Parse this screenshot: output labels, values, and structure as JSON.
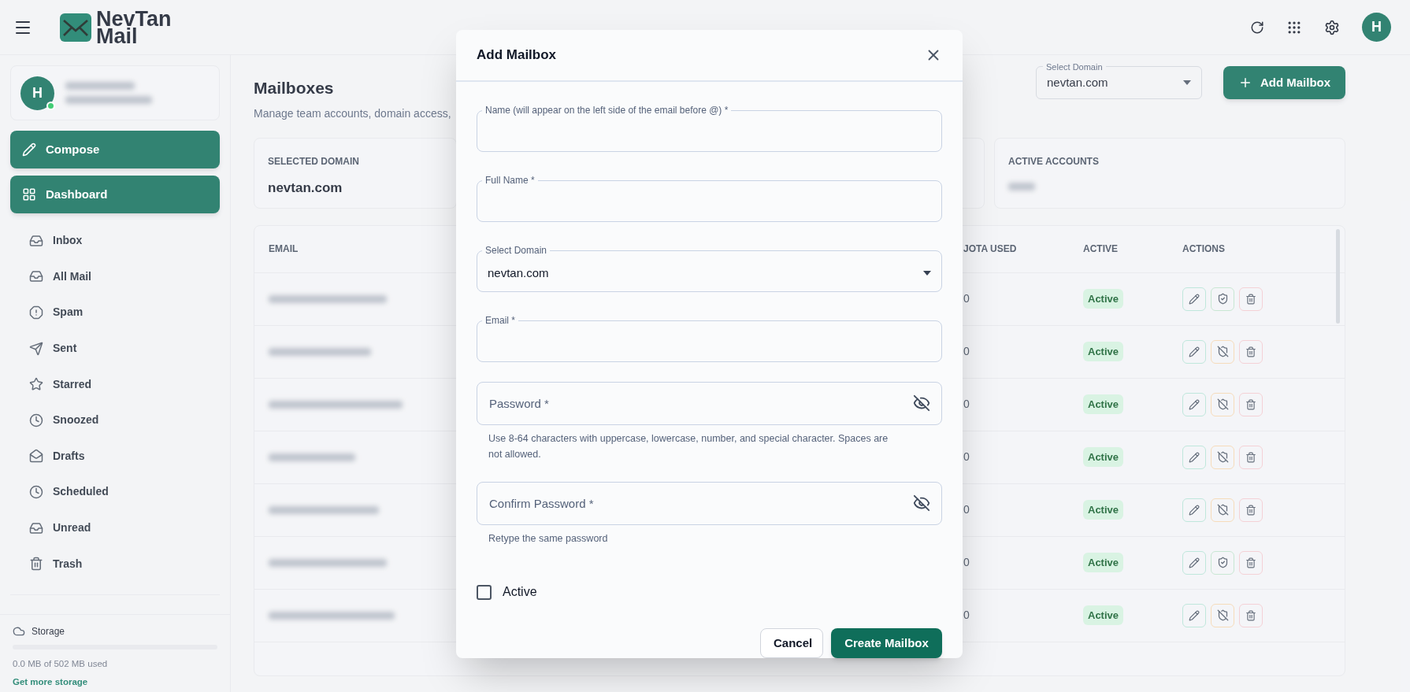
{
  "header": {
    "brand_line1": "NevTan",
    "brand_line2": "Mail",
    "avatar_initial": "H"
  },
  "sidebar": {
    "user": {
      "initial": "H",
      "online": true
    },
    "primary_buttons": [
      {
        "label": "Compose",
        "kind": "compose"
      },
      {
        "label": "Dashboard",
        "kind": "dashboard"
      }
    ],
    "items": [
      {
        "label": "Inbox",
        "kind": "inbox"
      },
      {
        "label": "All Mail",
        "kind": "inbox"
      },
      {
        "label": "Spam",
        "kind": "spam"
      },
      {
        "label": "Sent",
        "kind": "sent"
      },
      {
        "label": "Starred",
        "kind": "star"
      },
      {
        "label": "Snoozed",
        "kind": "clock"
      },
      {
        "label": "Drafts",
        "kind": "drafts"
      },
      {
        "label": "Scheduled",
        "kind": "clock"
      },
      {
        "label": "Unread",
        "kind": "inbox"
      },
      {
        "label": "Trash",
        "kind": "trash"
      }
    ],
    "storage": {
      "title": "Storage",
      "level": 0,
      "usage": "0.0 MB of 502 MB used",
      "link": "Get more storage"
    }
  },
  "page": {
    "title": "Mailboxes",
    "subtitle": "Manage team accounts, domain access,",
    "domain_select": {
      "label": "Select Domain",
      "value": "nevtan.com"
    },
    "add_button": "Add Mailbox",
    "stats": [
      {
        "label": "SELECTED DOMAIN",
        "value": "nevtan.com"
      },
      {
        "label": "ACTIVE ACCOUNTS"
      }
    ]
  },
  "table": {
    "columns": [
      "EMAIL",
      "JOTA USED",
      "ACTIVE",
      "ACTIONS"
    ],
    "rows": [
      {
        "quota": "0",
        "status": "Active",
        "access_blocked": false
      },
      {
        "quota": "0",
        "status": "Active",
        "access_blocked": true
      },
      {
        "quota": "0",
        "status": "Active",
        "access_blocked": true
      },
      {
        "quota": "0",
        "status": "Active",
        "access_blocked": true
      },
      {
        "quota": "0",
        "status": "Active",
        "access_blocked": true
      },
      {
        "quota": "0",
        "status": "Active",
        "access_blocked": false
      },
      {
        "quota": "0",
        "status": "Active",
        "access_blocked": true
      }
    ]
  },
  "modal": {
    "title": "Add Mailbox",
    "fields": [
      {
        "kind": "text",
        "label": "Name (will appear on the left side of the email before @) *"
      },
      {
        "kind": "text",
        "label": "Full Name *"
      },
      {
        "kind": "select",
        "label": "Select Domain",
        "value": "nevtan.com"
      },
      {
        "kind": "text",
        "label": "Email *"
      },
      {
        "kind": "password",
        "placeholder": "Password *",
        "helper": "Use 8-64 characters with uppercase, lowercase, number, and special character. Spaces are not allowed."
      },
      {
        "kind": "password",
        "placeholder": "Confirm Password *",
        "helper": "Retype the same password"
      }
    ],
    "active_checkbox": {
      "label": "Active",
      "checked": false
    },
    "buttons": [
      {
        "label": "Cancel",
        "kind": "secondary"
      },
      {
        "label": "Create Mailbox",
        "kind": "primary"
      }
    ]
  }
}
